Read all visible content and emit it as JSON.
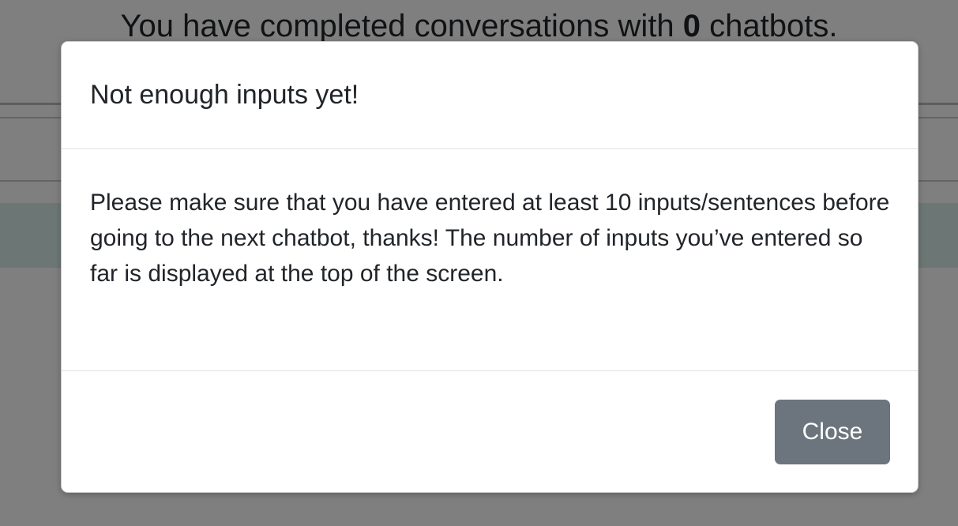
{
  "background": {
    "headline_prefix": "You have completed conversations with ",
    "headline_count": "0",
    "headline_suffix": " chatbots."
  },
  "modal": {
    "title": "Not enough inputs yet!",
    "body_text": "Please make sure that you have entered at least 10 inputs/sentences before going to the next chatbot, thanks! The number of inputs you’ve entered so far is displayed at the top of the screen.",
    "close_label": "Close"
  },
  "colors": {
    "close_button_bg": "#6c757d",
    "backdrop": "rgba(0,0,0,0.5)"
  }
}
